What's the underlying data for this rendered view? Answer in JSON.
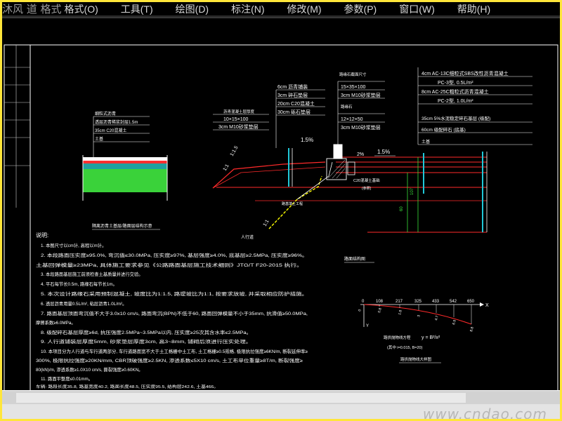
{
  "app": {
    "brand": "沐风 道   格式"
  },
  "menu": {
    "items": [
      {
        "label": "格式(O)"
      },
      {
        "label": "工具(T)"
      },
      {
        "label": "绘图(D)"
      },
      {
        "label": "标注(N)"
      },
      {
        "label": "修改(M)"
      },
      {
        "label": "参数(P)"
      },
      {
        "label": "窗口(W)"
      },
      {
        "label": "帮助(H)"
      }
    ]
  },
  "drawing": {
    "left_section": {
      "layers": [
        "细粒式沥青",
        "透层沥青稀浆封层1.5m",
        "35cm C20混凝土",
        "土基"
      ],
      "caption": "隔离沥青土基层/路面层结构示意"
    },
    "mid_left": {
      "layers": [
        "沥青混凝土层厚度",
        "10×15×100",
        "3cm M10砂浆垫层"
      ],
      "slope": "1.5%",
      "ratio": "1:1.5",
      "ratio_bottom": "1:1",
      "caption": "人行道"
    },
    "center_column": {
      "layers": [
        "6cm 沥青铺装",
        "3cm 碎石垫层",
        "20cm C20混凝土",
        "30cm 砾石垫层"
      ]
    },
    "curb": {
      "header": "路缘石截面尺寸",
      "layers": [
        "15×35×100",
        "3cm M10砂浆垫层",
        "路缘石",
        "12×12×50",
        "3cm M10砂浆垫层"
      ],
      "slope_a": "2%",
      "slope_b": "1.5%",
      "label_c": "C20混凝土基础",
      "label_sub": "(参照)",
      "back_label": "路基填土工程"
    },
    "right_table": {
      "rows": [
        "4cm AC-13C细粒式SBS改性沥青混凝土",
        "PC-3型, 0.5L/m²",
        "8cm AC-25C粗粒式沥青混凝土",
        "PC-2型, 1.0L/m²",
        "35cm 5%水泥稳定碎石基层 (级配)",
        "60cm 级配碎石 (底基)",
        "土基"
      ],
      "dims": [
        "60",
        "107"
      ],
      "caption": "路面结构图"
    },
    "notes": {
      "title": "说明:",
      "lines": [
        "1. 本图尺寸以cm计, 高程以m计。",
        "2. 本段路面压实度≥95.0%, 弯沉值≤30.0MPa, 压实度≥97%, 基层强度≥4.0%, 底基层≥2.5MPa, 压实度≥96%。",
        "   土基回弹模量≥23MPa, 具体施工要求参见《公路路面基层施工技术细则》JTG/T F20-2015 执行。",
        "3. 本段路面基层施工前须检查土基质量并进行交验。",
        "4. 平石每节长0.5m, 路缘石每节长1m。",
        "5. 本次设计路缘石采用预制混凝土, 坡度比为1:1.5, 路堤坡比为1:1, 按要求放坡, 并采取相应防护措施。",
        "6. 透层沥青用量0.5L/m², 粘层沥青1.0L/m²。",
        "7. 路面基层顶面弯沉值不大于3.0x10 cm/s, 路面弯沉(BPN)不低于60, 路面回弹模量不小于35mm, 抗滑值≥50.0MPa,",
        "   摩擦系数≥6.0MPa。",
        "8. 级配碎石基层厚度≥6d, 抗压强度2.5MPa~3.5MPa以内, 压实度≥25次其含水率≤2.5MPa。",
        "9. 人行道铺装层厚度5mm, 砂浆垫层厚度3cm, 高3~8mm, 铺砌后须进行压实处理。",
        "10. 本项目分为人行道与车行道两部分, 车行道路面宽不大于土工格栅中土工布, 土工格栅≥0.5规格, 极限抗拉强度≥6KN/m, 断裂延伸率≥",
        "300%, 极限抗拉强度≥20KN/mm, CBR顶破强度≥2.5KN, 渗透系数≤5X10 cm/s, 土工布单位重量≥8T/m, 断裂强度≥",
        "80(kN)/m, 渗透系数≥1.0X10 cm/s, 撕裂强度≥0.60KN。",
        "11. 路面平整度≤0.01mm。",
        "车辆: 路段长度35.8, 路基宽度40.2, 路面长度48.5, 压实度95.5, 结构层242.6, 土基466。"
      ]
    },
    "profile": {
      "x_values": [
        "0",
        "108",
        "217",
        "325",
        "433",
        "542",
        "650"
      ],
      "y_values": [
        "0",
        "0.8",
        "1.8",
        "3",
        "4.7",
        "6.9",
        "8.8"
      ],
      "x_axis": "X",
      "y_axis": "Y",
      "formula_label": "路拱抛物线方程",
      "formula": "y = B²/x²",
      "params": "(其中 i=0.015, B=20)",
      "caption": "路拱抛物线大样图"
    }
  },
  "watermark": "www.cndao.com",
  "colors": {
    "frame": "#ffe63a",
    "cad_bg": "#000000",
    "red": "#ff2a2a",
    "white": "#ffffff",
    "cyan": "#00c8d8",
    "green": "#3ae03a",
    "yellow": "#ffff00"
  }
}
